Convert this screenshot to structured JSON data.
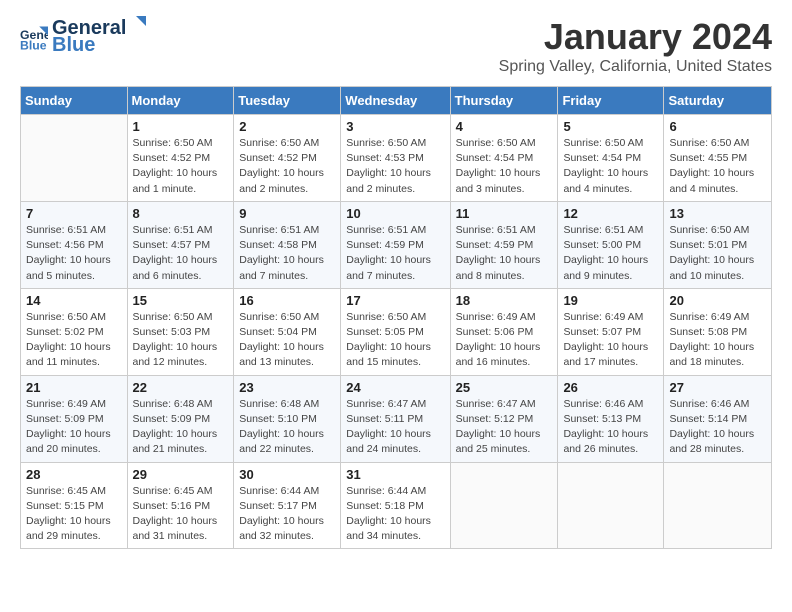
{
  "header": {
    "logo_line1": "General",
    "logo_line2": "Blue",
    "title": "January 2024",
    "subtitle": "Spring Valley, California, United States"
  },
  "columns": [
    "Sunday",
    "Monday",
    "Tuesday",
    "Wednesday",
    "Thursday",
    "Friday",
    "Saturday"
  ],
  "weeks": [
    [
      {
        "num": "",
        "detail": ""
      },
      {
        "num": "1",
        "detail": "Sunrise: 6:50 AM\nSunset: 4:52 PM\nDaylight: 10 hours\nand 1 minute."
      },
      {
        "num": "2",
        "detail": "Sunrise: 6:50 AM\nSunset: 4:52 PM\nDaylight: 10 hours\nand 2 minutes."
      },
      {
        "num": "3",
        "detail": "Sunrise: 6:50 AM\nSunset: 4:53 PM\nDaylight: 10 hours\nand 2 minutes."
      },
      {
        "num": "4",
        "detail": "Sunrise: 6:50 AM\nSunset: 4:54 PM\nDaylight: 10 hours\nand 3 minutes."
      },
      {
        "num": "5",
        "detail": "Sunrise: 6:50 AM\nSunset: 4:54 PM\nDaylight: 10 hours\nand 4 minutes."
      },
      {
        "num": "6",
        "detail": "Sunrise: 6:50 AM\nSunset: 4:55 PM\nDaylight: 10 hours\nand 4 minutes."
      }
    ],
    [
      {
        "num": "7",
        "detail": "Sunrise: 6:51 AM\nSunset: 4:56 PM\nDaylight: 10 hours\nand 5 minutes."
      },
      {
        "num": "8",
        "detail": "Sunrise: 6:51 AM\nSunset: 4:57 PM\nDaylight: 10 hours\nand 6 minutes."
      },
      {
        "num": "9",
        "detail": "Sunrise: 6:51 AM\nSunset: 4:58 PM\nDaylight: 10 hours\nand 7 minutes."
      },
      {
        "num": "10",
        "detail": "Sunrise: 6:51 AM\nSunset: 4:59 PM\nDaylight: 10 hours\nand 7 minutes."
      },
      {
        "num": "11",
        "detail": "Sunrise: 6:51 AM\nSunset: 4:59 PM\nDaylight: 10 hours\nand 8 minutes."
      },
      {
        "num": "12",
        "detail": "Sunrise: 6:51 AM\nSunset: 5:00 PM\nDaylight: 10 hours\nand 9 minutes."
      },
      {
        "num": "13",
        "detail": "Sunrise: 6:50 AM\nSunset: 5:01 PM\nDaylight: 10 hours\nand 10 minutes."
      }
    ],
    [
      {
        "num": "14",
        "detail": "Sunrise: 6:50 AM\nSunset: 5:02 PM\nDaylight: 10 hours\nand 11 minutes."
      },
      {
        "num": "15",
        "detail": "Sunrise: 6:50 AM\nSunset: 5:03 PM\nDaylight: 10 hours\nand 12 minutes."
      },
      {
        "num": "16",
        "detail": "Sunrise: 6:50 AM\nSunset: 5:04 PM\nDaylight: 10 hours\nand 13 minutes."
      },
      {
        "num": "17",
        "detail": "Sunrise: 6:50 AM\nSunset: 5:05 PM\nDaylight: 10 hours\nand 15 minutes."
      },
      {
        "num": "18",
        "detail": "Sunrise: 6:49 AM\nSunset: 5:06 PM\nDaylight: 10 hours\nand 16 minutes."
      },
      {
        "num": "19",
        "detail": "Sunrise: 6:49 AM\nSunset: 5:07 PM\nDaylight: 10 hours\nand 17 minutes."
      },
      {
        "num": "20",
        "detail": "Sunrise: 6:49 AM\nSunset: 5:08 PM\nDaylight: 10 hours\nand 18 minutes."
      }
    ],
    [
      {
        "num": "21",
        "detail": "Sunrise: 6:49 AM\nSunset: 5:09 PM\nDaylight: 10 hours\nand 20 minutes."
      },
      {
        "num": "22",
        "detail": "Sunrise: 6:48 AM\nSunset: 5:09 PM\nDaylight: 10 hours\nand 21 minutes."
      },
      {
        "num": "23",
        "detail": "Sunrise: 6:48 AM\nSunset: 5:10 PM\nDaylight: 10 hours\nand 22 minutes."
      },
      {
        "num": "24",
        "detail": "Sunrise: 6:47 AM\nSunset: 5:11 PM\nDaylight: 10 hours\nand 24 minutes."
      },
      {
        "num": "25",
        "detail": "Sunrise: 6:47 AM\nSunset: 5:12 PM\nDaylight: 10 hours\nand 25 minutes."
      },
      {
        "num": "26",
        "detail": "Sunrise: 6:46 AM\nSunset: 5:13 PM\nDaylight: 10 hours\nand 26 minutes."
      },
      {
        "num": "27",
        "detail": "Sunrise: 6:46 AM\nSunset: 5:14 PM\nDaylight: 10 hours\nand 28 minutes."
      }
    ],
    [
      {
        "num": "28",
        "detail": "Sunrise: 6:45 AM\nSunset: 5:15 PM\nDaylight: 10 hours\nand 29 minutes."
      },
      {
        "num": "29",
        "detail": "Sunrise: 6:45 AM\nSunset: 5:16 PM\nDaylight: 10 hours\nand 31 minutes."
      },
      {
        "num": "30",
        "detail": "Sunrise: 6:44 AM\nSunset: 5:17 PM\nDaylight: 10 hours\nand 32 minutes."
      },
      {
        "num": "31",
        "detail": "Sunrise: 6:44 AM\nSunset: 5:18 PM\nDaylight: 10 hours\nand 34 minutes."
      },
      {
        "num": "",
        "detail": ""
      },
      {
        "num": "",
        "detail": ""
      },
      {
        "num": "",
        "detail": ""
      }
    ]
  ]
}
